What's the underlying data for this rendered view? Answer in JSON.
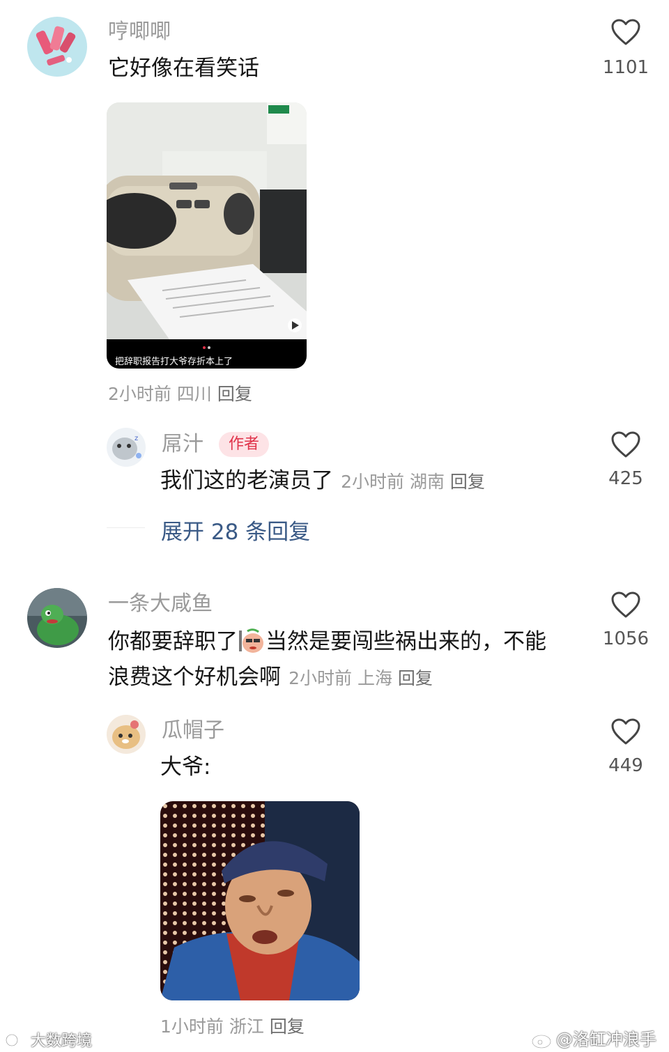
{
  "comments": [
    {
      "username": "哼唧唧",
      "text": "它好像在看笑话",
      "likes": "1101",
      "image_caption": "把辞职报告打大爷存折本上了",
      "meta": {
        "time": "2小时前",
        "location": "四川",
        "reply": "回复"
      },
      "replies": [
        {
          "username": "屌汁",
          "badge": "作者",
          "text": "我们这的老演员了",
          "likes": "425",
          "meta": {
            "time": "2小时前",
            "location": "湖南",
            "reply": "回复"
          }
        }
      ],
      "expand_label": "展开 28 条回复"
    },
    {
      "username": "一条大咸鱼",
      "text_line1_a": "你都要辞职了",
      "text_line1_b": "当然是要闯些祸出来的，不能",
      "text_line2": "浪费这个好机会啊",
      "likes": "1056",
      "meta": {
        "time": "2小时前",
        "location": "上海",
        "reply": "回复"
      },
      "replies": [
        {
          "username": "瓜帽子",
          "text": "大爷:",
          "likes": "449",
          "meta": {
            "time": "1小时前",
            "location": "浙江",
            "reply": "回复"
          }
        }
      ]
    }
  ],
  "watermarks": {
    "left": "大数跨境",
    "right": "@洛缸冲浪手"
  },
  "icons": {
    "like": "heart-outline-icon",
    "weibo": "weibo-logo-icon"
  },
  "colors": {
    "accent_badge": "#e0334a",
    "expand_link": "#3a5a86",
    "muted_text": "#9a9a9a"
  }
}
